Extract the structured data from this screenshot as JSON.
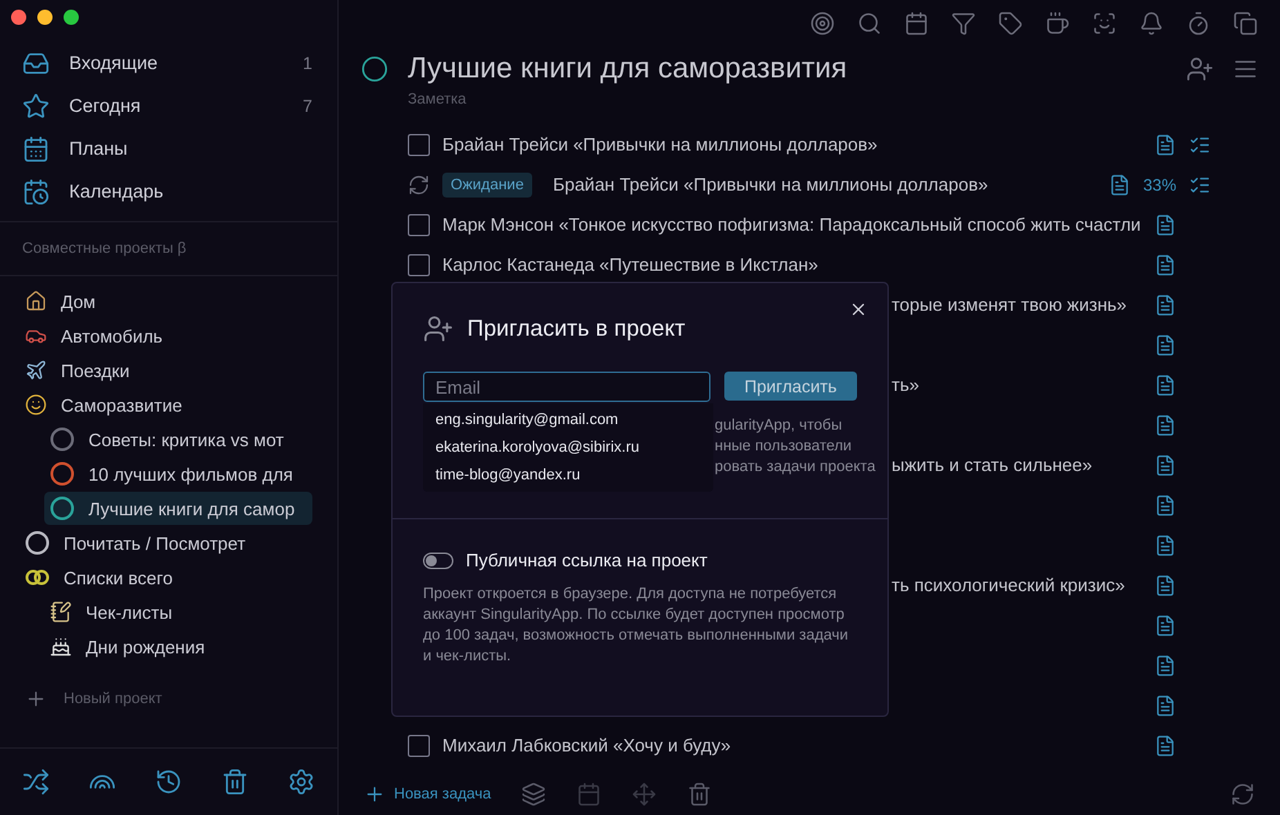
{
  "sidebar": {
    "nav": [
      {
        "label": "Входящие",
        "count": "1"
      },
      {
        "label": "Сегодня",
        "count": "7"
      },
      {
        "label": "Планы"
      },
      {
        "label": "Календарь"
      }
    ],
    "section_title": "Совместные проекты β",
    "projects": [
      {
        "label": "Дом",
        "selected": false
      },
      {
        "label": "Автомобиль",
        "selected": false
      },
      {
        "label": "Поездки",
        "selected": false
      },
      {
        "label": "Саморазвитие",
        "selected": false,
        "children": [
          {
            "color": "#6b6b78",
            "label": "Советы: критика vs мот",
            "selected": false
          },
          {
            "color": "#d0502e",
            "label": "10 лучших фильмов для",
            "selected": false
          },
          {
            "color": "#2aa39a",
            "label": "Лучшие книги для самор",
            "selected": true
          }
        ]
      },
      {
        "color": "#b8b8c0",
        "label": "Почитать / Посмотрет",
        "selected": false
      },
      {
        "label": "Списки всего",
        "selected": false,
        "children": [
          {
            "label": "Чек-листы",
            "selected": false
          },
          {
            "label": "Дни рождения",
            "selected": false
          }
        ]
      }
    ],
    "new_project": "Новый проект"
  },
  "header": {
    "title": "Лучшие книги для саморазвития",
    "subtitle": "Заметка"
  },
  "tasks": [
    {
      "kind": "task",
      "text": "Брайан Трейси «Привычки на миллионы долларов»",
      "checked": false,
      "checklist": true
    },
    {
      "kind": "repeat",
      "tag": "Ожидание",
      "text": "Брайан Трейси «Привычки на миллионы долларов»",
      "progress": "33%",
      "checklist": true
    },
    {
      "kind": "task",
      "text": "Марк Мэнсон «Тонкое искусство пофигизма: Парадоксальный способ жить счастли",
      "checked": false,
      "checklist": false
    },
    {
      "kind": "task",
      "text": "Карлос Кастанеда «Путешествие в Икстлан»",
      "checked": false,
      "checklist": false
    },
    {
      "kind": "covered",
      "text": "торые изменят твою жизнь»"
    },
    {
      "kind": "covered"
    },
    {
      "kind": "covered",
      "text": "ть»"
    },
    {
      "kind": "covered"
    },
    {
      "kind": "covered",
      "text": "ыжить и стать сильнее»"
    },
    {
      "kind": "covered"
    },
    {
      "kind": "covered"
    },
    {
      "kind": "covered",
      "text": "ть психологический кризис»"
    },
    {
      "kind": "covered"
    },
    {
      "kind": "covered"
    },
    {
      "kind": "covered"
    },
    {
      "kind": "task",
      "text": "Михаил Лабковский «Хочу и буду»",
      "checked": false,
      "checklist": false
    }
  ],
  "footer": {
    "new_task": "Новая задача"
  },
  "dialog": {
    "title": "Пригласить в проект",
    "email": {
      "placeholder": "Email"
    },
    "invite_button": "Пригласить",
    "suggestions": [
      "eng.singularity@gmail.com",
      "ekaterina.korolyova@sibirix.ru",
      "time-blog@yandex.ru"
    ],
    "description_lines": [
      "gularityApp, чтобы",
      "нные пользователи",
      "ровать задачи проекта"
    ],
    "public_link": {
      "label": "Публичная ссылка на проект",
      "on": false
    },
    "public_description": "Проект откроется в браузере. Для доступа не потребуется аккаунт SingularityApp. По ссылке будет доступен просмотр до 100 задач, возможность отмечать выполненными задачи и чек-листы."
  }
}
